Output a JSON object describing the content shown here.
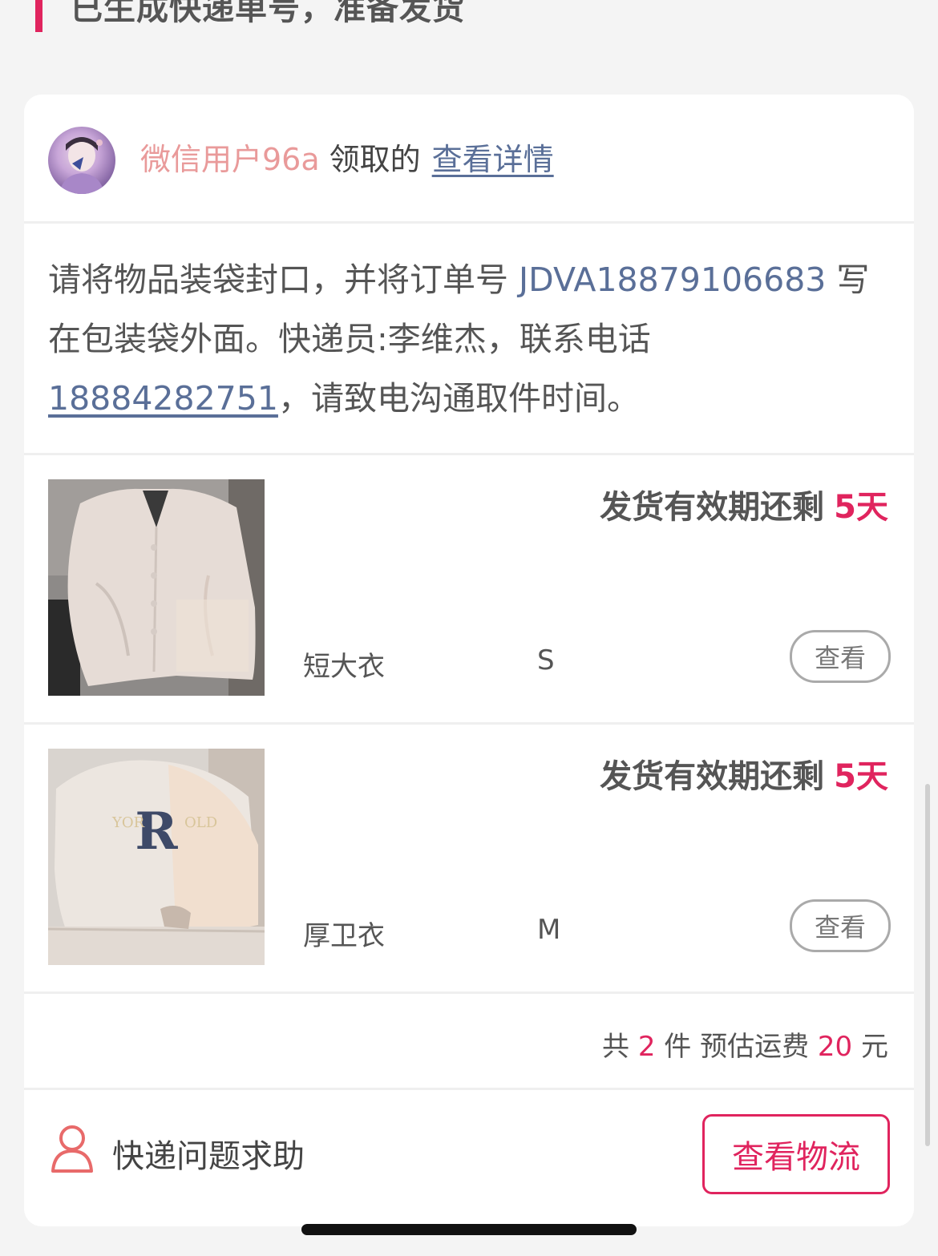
{
  "status": {
    "title": "已生成快递单号，准备发货",
    "accent_color": "#e0245e"
  },
  "claim": {
    "user": "微信用户96a",
    "text": "领取的",
    "detail_link": "查看详情",
    "avatar_icon": "user-avatar-photo"
  },
  "notice": {
    "prefix": "请将物品装袋封口，并将订单号 ",
    "order_no": "JDVA18879106683",
    "middle": " 写在包装袋外面。快递员:李维杰，联系电话",
    "phone": "18884282751",
    "suffix": "，请致电沟通取件时间。"
  },
  "items": [
    {
      "deadline_label": "发货有效期还剩",
      "deadline_days": "5天",
      "name": "短大衣",
      "size": "S",
      "view_label": "查看",
      "photo": "short-coat-photo"
    },
    {
      "deadline_label": "发货有效期还剩",
      "deadline_days": "5天",
      "name": "厚卫衣",
      "size": "M",
      "view_label": "查看",
      "photo": "sweatshirt-photo"
    }
  ],
  "summary": {
    "prefix": "共",
    "count": "2",
    "mid": "件 预估运费",
    "fee": "20",
    "unit": "元"
  },
  "footer": {
    "help_label": "快递问题求助",
    "help_icon": "person-icon",
    "logistics_button": "查看物流"
  },
  "colors": {
    "accent": "#e0245e",
    "link": "#5a6f98",
    "username": "#e99a9a"
  }
}
